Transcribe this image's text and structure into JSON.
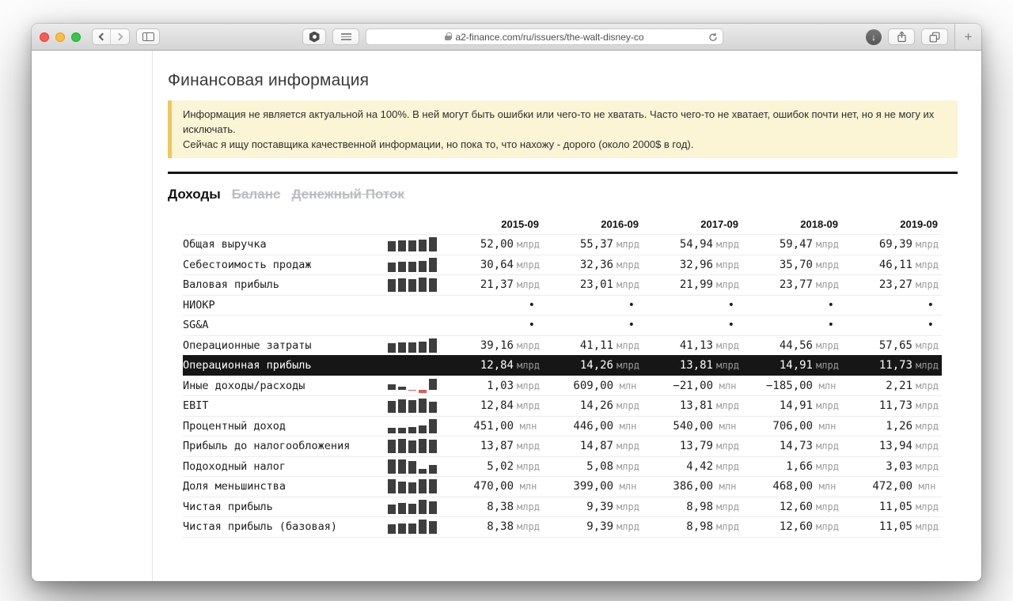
{
  "browser": {
    "url": "a2-finance.com/ru/issuers/the-walt-disney-co",
    "new_tab_label": "+",
    "icons": [
      "close-traffic-light",
      "minimize-traffic-light",
      "zoom-traffic-light",
      "back-icon",
      "forward-icon",
      "sidebar-icon",
      "extension-hexagon-icon",
      "extension-lines-icon",
      "lock-icon",
      "reload-icon",
      "downloads-icon",
      "share-icon",
      "tab-overview-icon",
      "new-tab-icon"
    ]
  },
  "page": {
    "title": "Финансовая информация",
    "warning_line1": "Информация не является актуальной на 100%. В ней могут быть ошибки или чего-то не хватать. Часто чего-то не хватает, ошибок почти нет, но я не могу их исключать.",
    "warning_line2": "Сейчас я ищу поставщика качественной информации, но пока то, что нахожу - дорого (около 2000$ в год).",
    "tabs": [
      {
        "label": "Доходы",
        "active": true
      },
      {
        "label": "Баланс",
        "active": false
      },
      {
        "label": "Денежный Поток",
        "active": false
      }
    ]
  },
  "colors": {
    "warning_bg": "#fbf4d5",
    "warning_border": "#f0c75e",
    "highlight_row_bg": "#161616",
    "spark_bar": "#3e3e3e",
    "spark_negative": "#df5a56",
    "unit_text": "#9b9b9b",
    "tab_inactive": "#b9bdc2"
  },
  "table": {
    "columns": [
      "2015-09",
      "2016-09",
      "2017-09",
      "2018-09",
      "2019-09"
    ],
    "rows": [
      {
        "label": "Общая выручка",
        "highlight": false,
        "spark": [
          52.0,
          55.37,
          54.94,
          59.47,
          69.39
        ],
        "cells": [
          [
            "52,00",
            "млрд"
          ],
          [
            "55,37",
            "млрд"
          ],
          [
            "54,94",
            "млрд"
          ],
          [
            "59,47",
            "млрд"
          ],
          [
            "69,39",
            "млрд"
          ]
        ]
      },
      {
        "label": "Себестоимость продаж",
        "highlight": false,
        "spark": [
          30.64,
          32.36,
          32.96,
          35.7,
          46.11
        ],
        "cells": [
          [
            "30,64",
            "млрд"
          ],
          [
            "32,36",
            "млрд"
          ],
          [
            "32,96",
            "млрд"
          ],
          [
            "35,70",
            "млрд"
          ],
          [
            "46,11",
            "млрд"
          ]
        ]
      },
      {
        "label": "Валовая прибыль",
        "highlight": false,
        "spark": [
          21.37,
          23.01,
          21.99,
          23.77,
          23.27
        ],
        "cells": [
          [
            "21,37",
            "млрд"
          ],
          [
            "23,01",
            "млрд"
          ],
          [
            "21,99",
            "млрд"
          ],
          [
            "23,77",
            "млрд"
          ],
          [
            "23,27",
            "млрд"
          ]
        ]
      },
      {
        "label": "НИОКР",
        "highlight": false,
        "spark": null,
        "cells": [
          [
            "•",
            ""
          ],
          [
            "•",
            ""
          ],
          [
            "•",
            ""
          ],
          [
            "•",
            ""
          ],
          [
            "•",
            ""
          ]
        ]
      },
      {
        "label": "SG&A",
        "highlight": false,
        "spark": null,
        "cells": [
          [
            "•",
            ""
          ],
          [
            "•",
            ""
          ],
          [
            "•",
            ""
          ],
          [
            "•",
            ""
          ],
          [
            "•",
            ""
          ]
        ]
      },
      {
        "label": "Операционные затраты",
        "highlight": false,
        "spark": [
          39.16,
          41.11,
          41.13,
          44.56,
          57.65
        ],
        "cells": [
          [
            "39,16",
            "млрд"
          ],
          [
            "41,11",
            "млрд"
          ],
          [
            "41,13",
            "млрд"
          ],
          [
            "44,56",
            "млрд"
          ],
          [
            "57,65",
            "млрд"
          ]
        ]
      },
      {
        "label": "Операционная прибыль",
        "highlight": true,
        "spark": null,
        "cells": [
          [
            "12,84",
            "млрд"
          ],
          [
            "14,26",
            "млрд"
          ],
          [
            "13,81",
            "млрд"
          ],
          [
            "14,91",
            "млрд"
          ],
          [
            "11,73",
            "млрд"
          ]
        ]
      },
      {
        "label": "Иные доходы/расходы",
        "highlight": false,
        "spark": [
          1.03,
          0.609,
          -0.021,
          -0.185,
          2.21
        ],
        "cells": [
          [
            "1,03",
            "млрд"
          ],
          [
            "609,00",
            "млн"
          ],
          [
            "−21,00",
            "млн"
          ],
          [
            "−185,00",
            "млн"
          ],
          [
            "2,21",
            "млрд"
          ]
        ]
      },
      {
        "label": "EBIT",
        "highlight": false,
        "spark": [
          12.84,
          14.26,
          13.81,
          14.91,
          11.73
        ],
        "cells": [
          [
            "12,84",
            "млрд"
          ],
          [
            "14,26",
            "млрд"
          ],
          [
            "13,81",
            "млрд"
          ],
          [
            "14,91",
            "млрд"
          ],
          [
            "11,73",
            "млрд"
          ]
        ]
      },
      {
        "label": "Процентный доход",
        "highlight": false,
        "spark": [
          0.451,
          0.446,
          0.54,
          0.706,
          1.26
        ],
        "cells": [
          [
            "451,00",
            "млн"
          ],
          [
            "446,00",
            "млн"
          ],
          [
            "540,00",
            "млн"
          ],
          [
            "706,00",
            "млн"
          ],
          [
            "1,26",
            "млрд"
          ]
        ]
      },
      {
        "label": "Прибыль до налогообложения",
        "highlight": false,
        "spark": [
          13.87,
          14.87,
          13.79,
          14.73,
          13.94
        ],
        "cells": [
          [
            "13,87",
            "млрд"
          ],
          [
            "14,87",
            "млрд"
          ],
          [
            "13,79",
            "млрд"
          ],
          [
            "14,73",
            "млрд"
          ],
          [
            "13,94",
            "млрд"
          ]
        ]
      },
      {
        "label": "Подоходный налог",
        "highlight": false,
        "spark": [
          5.02,
          5.08,
          4.42,
          1.66,
          3.03
        ],
        "cells": [
          [
            "5,02",
            "млрд"
          ],
          [
            "5,08",
            "млрд"
          ],
          [
            "4,42",
            "млрд"
          ],
          [
            "1,66",
            "млрд"
          ],
          [
            "3,03",
            "млрд"
          ]
        ]
      },
      {
        "label": "Доля меньшинства",
        "highlight": false,
        "spark": [
          0.47,
          0.399,
          0.386,
          0.468,
          0.472
        ],
        "cells": [
          [
            "470,00",
            "млн"
          ],
          [
            "399,00",
            "млн"
          ],
          [
            "386,00",
            "млн"
          ],
          [
            "468,00",
            "млн"
          ],
          [
            "472,00",
            "млн"
          ]
        ]
      },
      {
        "label": "Чистая прибыль",
        "highlight": false,
        "spark": [
          8.38,
          9.39,
          8.98,
          12.6,
          11.05
        ],
        "cells": [
          [
            "8,38",
            "млрд"
          ],
          [
            "9,39",
            "млрд"
          ],
          [
            "8,98",
            "млрд"
          ],
          [
            "12,60",
            "млрд"
          ],
          [
            "11,05",
            "млрд"
          ]
        ]
      },
      {
        "label": "Чистая прибыль (базовая)",
        "highlight": false,
        "spark": [
          8.38,
          9.39,
          8.98,
          12.6,
          11.05
        ],
        "cells": [
          [
            "8,38",
            "млрд"
          ],
          [
            "9,39",
            "млрд"
          ],
          [
            "8,98",
            "млрд"
          ],
          [
            "12,60",
            "млрд"
          ],
          [
            "11,05",
            "млрд"
          ]
        ]
      }
    ]
  }
}
